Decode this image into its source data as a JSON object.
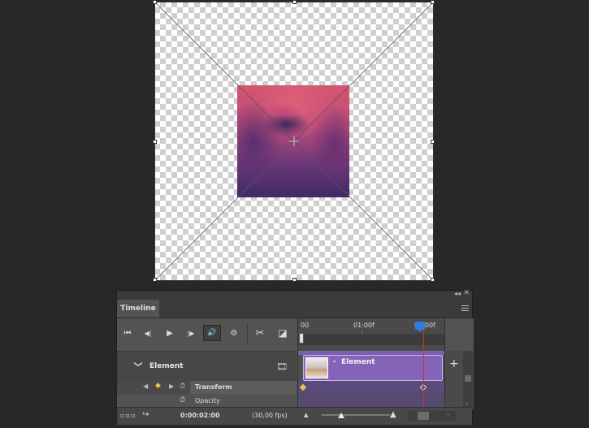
{
  "panel": {
    "tab_label": "Timeline",
    "collapse_symbol": "◂◂",
    "close_symbol": "✕"
  },
  "controls": {
    "first_frame": "⏮",
    "prev_frame": "◀|",
    "play": "▶",
    "next_frame": "|▶",
    "audio": "🔊",
    "settings": "⚙",
    "split": "✂",
    "transition": "◪"
  },
  "ruler": {
    "labels": [
      "00",
      "01:00f",
      "02:00f"
    ]
  },
  "track": {
    "name": "Element",
    "chevron": "❯",
    "film_icon": "🎞"
  },
  "properties": {
    "transform_label": "Transform",
    "opacity_label": "Opacity"
  },
  "clip": {
    "name": "Element"
  },
  "footer": {
    "timecode": "0:00:02:00",
    "fps": "(30,00 fps)"
  },
  "colors": {
    "clip": "#8563b8",
    "playhead": "#2f7de0",
    "playhead_line": "#d03030",
    "keyframe": "#e8c54a"
  }
}
